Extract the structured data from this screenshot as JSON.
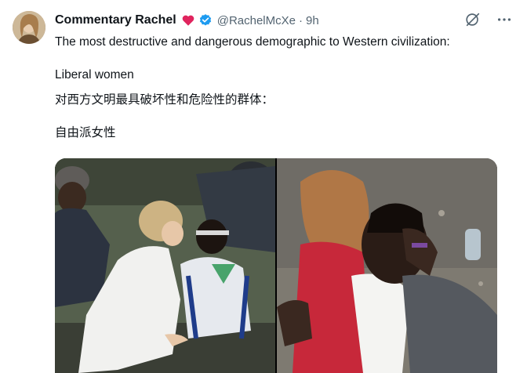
{
  "author": {
    "display_name": "Commentary Rachel",
    "handle": "@RachelMcXe",
    "time": "9h",
    "separator": "·"
  },
  "icons": {
    "heart": "heart-icon",
    "verified": "verified-badge-icon",
    "grok": "grok-icon",
    "more": "more-icon"
  },
  "post": {
    "line1": "The most destructive and dangerous demographic to Western civilization:",
    "line2": "Liberal women",
    "line3": "对西方文明最具破坏性和危险性的群体：",
    "line4": "自由派女性"
  },
  "colors": {
    "verified": "#1d9bf0",
    "heart": "#e0245e",
    "text": "#0f1419",
    "muted": "#536471"
  }
}
